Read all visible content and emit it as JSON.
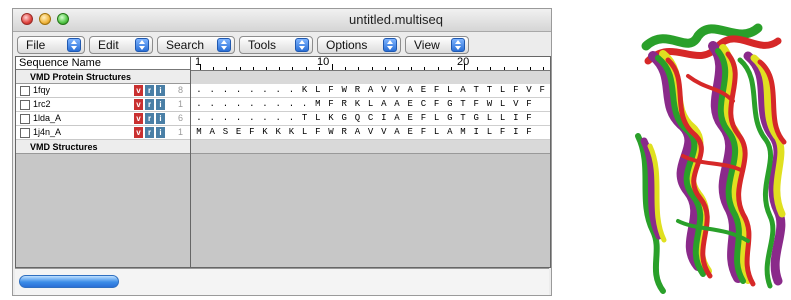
{
  "window": {
    "title": "untitled.multiseq"
  },
  "toolbar": {
    "menus": [
      "File",
      "Edit",
      "Search",
      "Tools",
      "Options",
      "View"
    ]
  },
  "left_panel": {
    "header": "Sequence Name",
    "groups": [
      {
        "label": "VMD Protein Structures",
        "rows": [
          {
            "name": "1fqy",
            "count": "8"
          },
          {
            "name": "1rc2",
            "count": "1"
          },
          {
            "name": "1lda_A",
            "count": "6"
          },
          {
            "name": "1j4n_A",
            "count": "1"
          }
        ]
      },
      {
        "label": "VMD Structures",
        "rows": []
      }
    ],
    "badges": [
      "v",
      "r",
      "i"
    ]
  },
  "right_panel": {
    "ruler": [
      "1",
      "10",
      "20"
    ],
    "sequences": [
      ". . . . . . . . K L F W R A V V A E F L A T T L F V F",
      ". . . . . . . . . M F R K L A A E C F G T F W L V F",
      ". . . . . . . . T L K G Q C I A E F L G T G L L I F",
      "M A S E F K K K L F W R A V V A E F L A M I L F I F"
    ]
  },
  "colors": {
    "badge_v": "#c93030",
    "badge_ri": "#4a7fa6",
    "scroll_thumb": "#3b8de8",
    "protein": [
      "#2aa02a",
      "#d62828",
      "#e0e020",
      "#8a2a8a"
    ]
  }
}
